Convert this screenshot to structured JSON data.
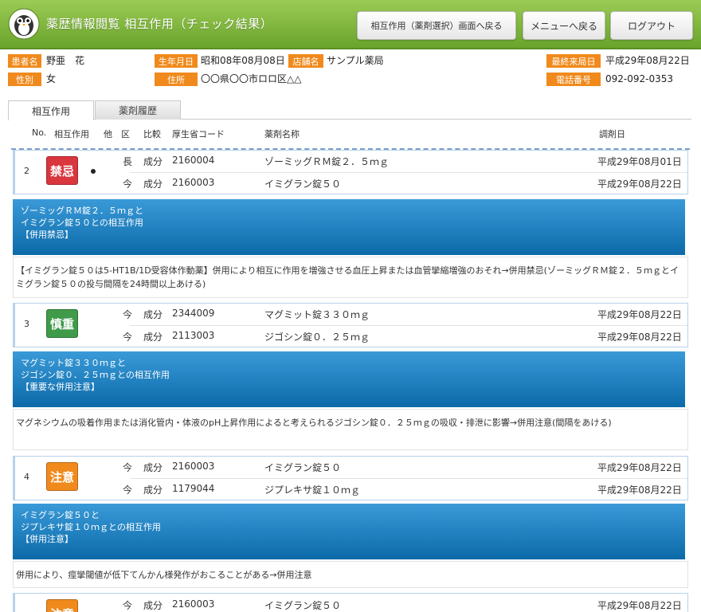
{
  "header": {
    "title": "薬歴情報閲覧 相互作用（チェック結果）",
    "btn_back_selection": "相互作用（薬剤選択）画面へ戻る",
    "btn_menu": "メニューへ戻る",
    "btn_logout": "ログアウト"
  },
  "patient": {
    "name_label": "患者名",
    "name": "野亜　花",
    "gender_label": "性別",
    "gender": "女",
    "birth_label": "生年月日",
    "birth": "昭和08年08月08日",
    "store_label": "店舗名",
    "store": "サンプル薬局",
    "address_label": "住所",
    "address": "〇〇県〇〇市ロロ区△△",
    "last_visit_label": "最終来局日",
    "last_visit": "平成29年08月22日",
    "phone_label": "電話番号",
    "phone": "092-092-0353"
  },
  "tabs": {
    "interaction": "相互作用",
    "history": "薬剤履歴"
  },
  "columns": {
    "no": "No.",
    "interaction": "相互作用",
    "other": "他",
    "ku": "区",
    "compare": "比較",
    "code": "厚生省コード",
    "drug_name": "薬剤名称",
    "date": "調剤日"
  },
  "entries": [
    {
      "no": "2",
      "badge": "禁忌",
      "badge_color": "#d9363e",
      "rows": [
        {
          "ku": "長",
          "compare": "成分",
          "code": "2160004",
          "name": "ゾーミッグＲＭ錠２．５ｍｇ",
          "date": "平成29年08月01日"
        },
        {
          "ku": "今",
          "compare": "成分",
          "code": "2160003",
          "name": "イミグラン錠５０",
          "date": "平成29年08月22日"
        }
      ],
      "banner": [
        "ゾーミッグＲＭ錠２．５ｍｇと",
        "イミグラン錠５０との相互作用",
        "【併用禁忌】"
      ],
      "description": "【イミグラン錠５０は5-HT1B/1D受容体作動薬】併用により相互に作用を増強させる血圧上昇または血管攣縮増強のおそれ→併用禁忌(ゾーミッグＲＭ錠２．５ｍｇとイミグラン錠５０の投与間隔を24時間以上あける)"
    },
    {
      "no": "3",
      "badge": "慎重",
      "badge_color": "#3f9a4a",
      "rows": [
        {
          "ku": "今",
          "compare": "成分",
          "code": "2344009",
          "name": "マグミット錠３３０ｍｇ",
          "date": "平成29年08月22日"
        },
        {
          "ku": "今",
          "compare": "成分",
          "code": "2113003",
          "name": "ジゴシン錠０．２５ｍｇ",
          "date": "平成29年08月22日"
        }
      ],
      "banner": [
        "マグミット錠３３０ｍｇと",
        "ジゴシン錠０．２５ｍｇとの相互作用",
        "【重要な併用注意】"
      ],
      "description": "マグネシウムの吸着作用または消化管内・体液のpH上昇作用によると考えられるジゴシン錠０．２５ｍｇの吸収・排泄に影響→併用注意(間隔をあける)"
    },
    {
      "no": "4",
      "badge": "注意",
      "badge_color": "#f08a1c",
      "rows": [
        {
          "ku": "今",
          "compare": "成分",
          "code": "2160003",
          "name": "イミグラン錠５０",
          "date": "平成29年08月22日"
        },
        {
          "ku": "今",
          "compare": "成分",
          "code": "1179044",
          "name": "ジプレキサ錠１０ｍｇ",
          "date": "平成29年08月22日"
        }
      ],
      "banner": [
        "イミグラン錠５０と",
        "ジプレキサ錠１０ｍｇとの相互作用",
        "【併用注意】"
      ],
      "description": "併用により、痙攣閾値が低下てんかん様発作がおこることがある→併用注意"
    },
    {
      "no": "",
      "badge": "注意",
      "badge_color": "#f08a1c",
      "rows": [
        {
          "ku": "今",
          "compare": "成分",
          "code": "2160003",
          "name": "イミグラン錠５０",
          "date": "平成29年08月22日"
        }
      ]
    }
  ]
}
